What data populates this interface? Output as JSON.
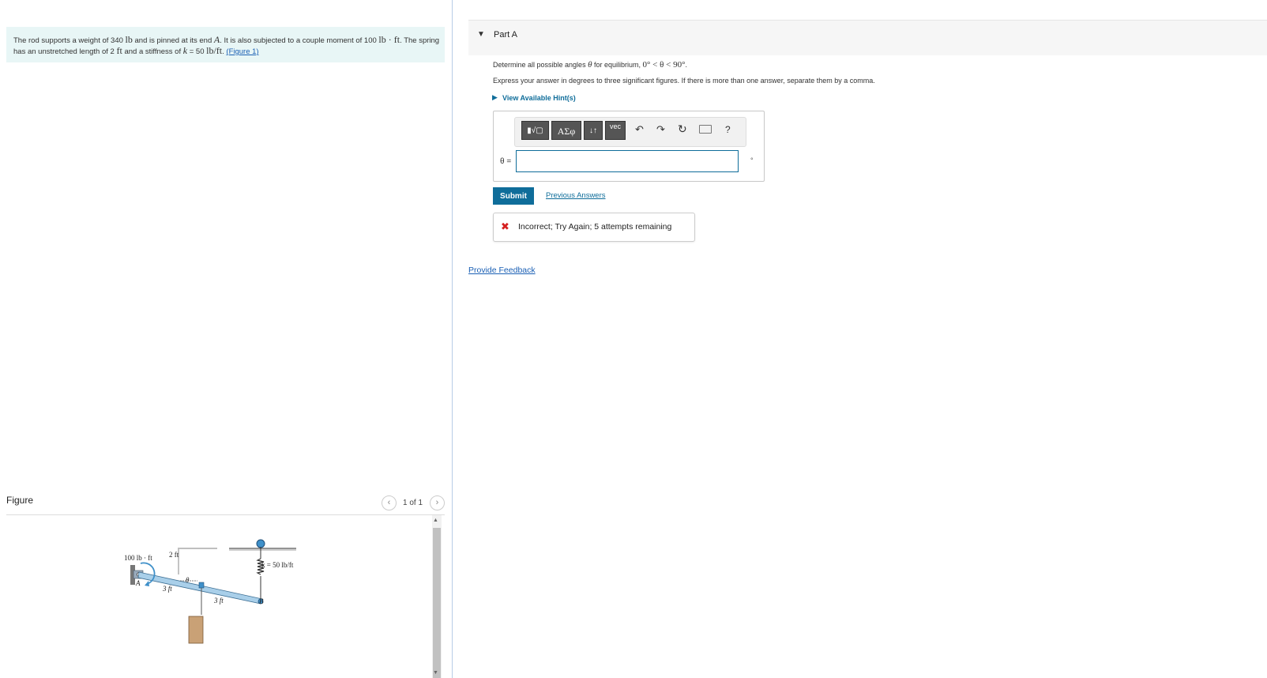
{
  "problem": {
    "t1": "The rod supports a weight of 340 ",
    "u_lb": "lb",
    "t2": " and is pinned at its end ",
    "point_a": "A",
    "t3": ". It is also subjected to a couple moment of 100 ",
    "u_lbft": "lb · ft",
    "t4": ". The spring has an unstretched length of 2 ",
    "u_ft": "ft",
    "t5": " and a stiffness of ",
    "k_sym": "k",
    "t6": " = 50 ",
    "u_lbperft": "lb/ft",
    "t7": ". ",
    "figure_link": "(Figure 1)"
  },
  "figure_panel": {
    "label": "Figure",
    "counter": "1 of 1",
    "prev_icon": "‹",
    "next_icon": "›"
  },
  "diagram": {
    "moment_label": "100 lb · ft",
    "dim_2ft": "2 ft",
    "dim_3ft_a": "3 ft",
    "dim_3ft_b": "3 ft",
    "theta": "θ",
    "point_a": "A",
    "point_b": "B",
    "k_label": "k = 50 lb/ft"
  },
  "part": {
    "caret": "▼",
    "title": "Part A"
  },
  "question": {
    "prefix": "Determine all possible angles ",
    "theta": "θ",
    "mid": " for equilibrium, ",
    "range": "0° < θ < 90°",
    "suffix": "."
  },
  "instruction": "Express your answer in degrees to three significant figures. If there is more than one answer, separate them by a comma.",
  "hints": {
    "caret": "▶",
    "label": "View Available Hint(s)"
  },
  "toolbar": {
    "templates_label": "▮√▢",
    "greek_label": "ΑΣφ",
    "updown_label": "↓↑",
    "vec_label": "vec",
    "undo_glyph": "↶",
    "redo_glyph": "↷",
    "reset_glyph": "↻",
    "help_glyph": "?"
  },
  "answer": {
    "var_label": "θ =",
    "value": "",
    "unit": "°"
  },
  "submit_label": "Submit",
  "previous_answers_label": "Previous Answers",
  "feedback": {
    "icon": "✖",
    "message": "Incorrect; Try Again; 5 attempts remaining"
  },
  "provide_feedback_label": "Provide Feedback",
  "colors": {
    "accent": "#0f6d9a",
    "error": "#d52020",
    "problem_bg": "#e8f6f6"
  }
}
